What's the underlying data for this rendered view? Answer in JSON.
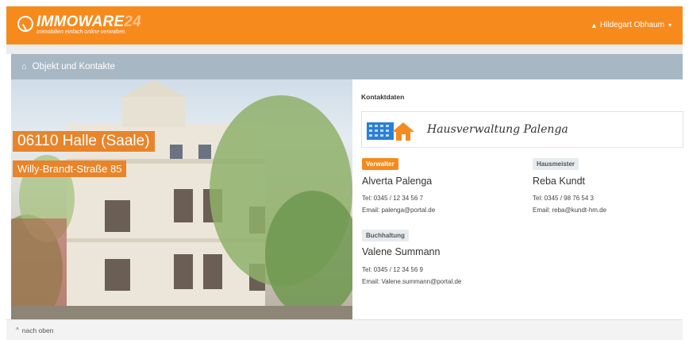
{
  "brand": {
    "name": "IMMOWARE",
    "name_suffix": "24",
    "tagline": "Immobilien einfach online verwalten.",
    "accent": "#f78a1d"
  },
  "user": {
    "name": "Hildegart Obhaum",
    "icon": "user-icon"
  },
  "panel": {
    "title": "Objekt und Kontakte",
    "icon": "home-icon"
  },
  "property": {
    "city": "06110 Halle (Saale)",
    "street": "Willy-Brandt-Straße 85"
  },
  "contacts": {
    "title": "Kontaktdaten",
    "company": "Hausverwaltung Palenga",
    "verwalter": {
      "role": "Verwalter",
      "name": "Alverta Palenga",
      "tel": "Tel: 0345 / 12 34 56 7",
      "email": "Email: palenga@portal.de"
    },
    "hausmeister": {
      "role": "Hausmeister",
      "name": "Reba Kundt",
      "tel": "Tel: 0345 / 98 76 54 3",
      "email": "Email: reba@kundt-hm.de"
    },
    "buchhaltung": {
      "role": "Buchhaltung",
      "name": "Valene Summann",
      "tel": "Tel: 0345 / 12 34 56 9",
      "email": "Email: Valene.summann@portal.de"
    }
  },
  "footer": {
    "back_to_top": "nach oben"
  }
}
